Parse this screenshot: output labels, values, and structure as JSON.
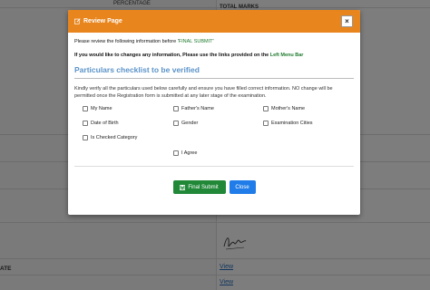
{
  "background": {
    "percentage_label": "PERCENTAGE",
    "total_marks_label": "TOTAL MARKS",
    "left_label": "ATE",
    "view_link_1": "View",
    "view_link_2": "View",
    "signature_text": "Signature"
  },
  "modal": {
    "title": "Review Page",
    "close_glyph": "×",
    "line1_prefix": "Please review the following information before '",
    "line1_accent": "FINAL SUBMIT",
    "line1_suffix": "'",
    "line2_prefix": "If you would like to changes any information, Please use the links provided on the ",
    "line2_accent": "Left Menu Bar",
    "section_title": "Particulars checklist to be verified",
    "notice": "Kindly verify all the particulars used below carefully and ensure you have filled correct information. NO change will be permitted once the Registration form is submitted at any later stage of the examination.",
    "checklist": {
      "my_name": "My Name",
      "fathers_name": "Father's Name",
      "mothers_name": "Mother's Name",
      "dob": "Date of Birth",
      "gender": "Gender",
      "exam_cities": "Examination Cities",
      "is_checked_category": "Is Checked Category",
      "i_agree": "I Agree"
    },
    "submit_label": "Final Submit",
    "close_label": "Close"
  },
  "colors": {
    "header": "#e8851d",
    "submit": "#218838",
    "close": "#1f7ce8",
    "section_title": "#5b93c9",
    "accent_green": "#1e7a2e"
  }
}
